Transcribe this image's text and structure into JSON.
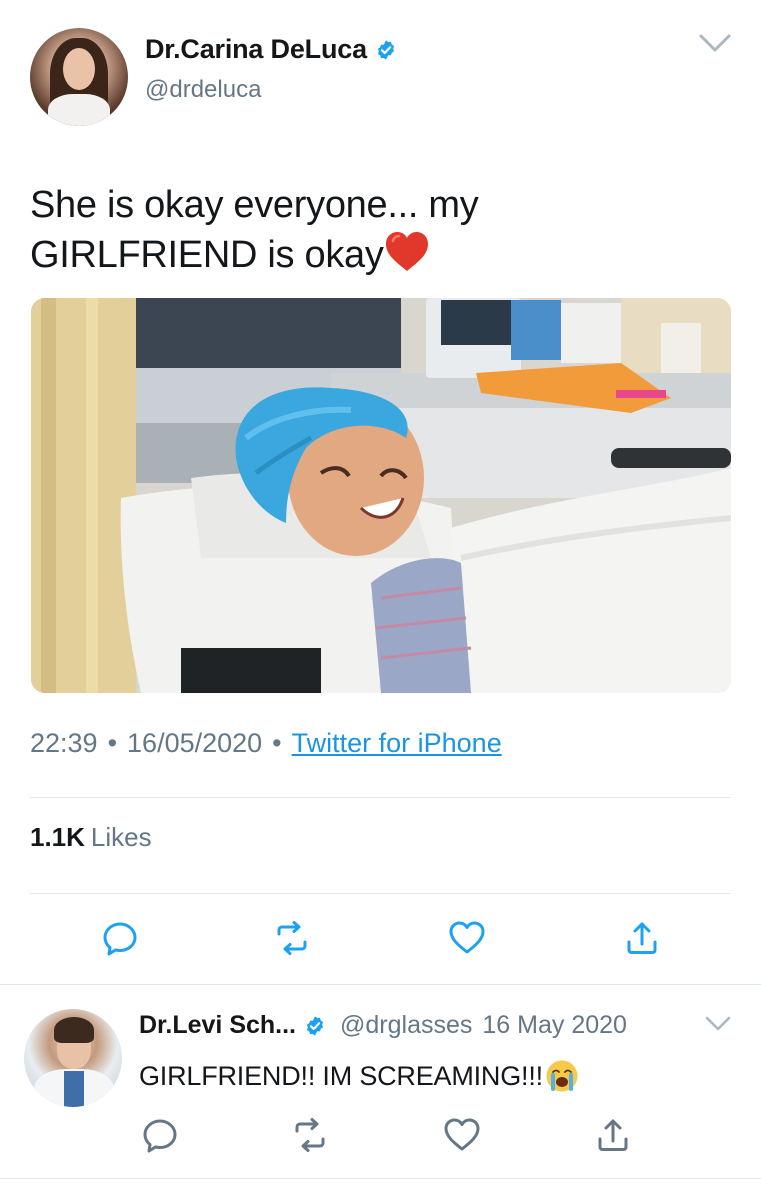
{
  "tweet": {
    "display_name": "Dr.Carina DeLuca",
    "handle": "@drdeluca",
    "text_line1": "She is okay everyone... my",
    "text_line2": "GIRLFRIEND is okay",
    "time": "22:39",
    "date": "16/05/2020",
    "separator": "•",
    "source": "Twitter for iPhone",
    "likes_count": "1.1K",
    "likes_label": "Likes"
  },
  "reply": {
    "display_name": "Dr.Levi Sch...",
    "handle": "@drglasses",
    "date": "16 May 2020",
    "text": "GIRLFRIEND!! IM SCREAMING!!!"
  },
  "icons": {
    "verified": "verified-badge-icon",
    "chevron": "chevron-down-icon",
    "heart_emoji": "red-heart-emoji",
    "cry_emoji": "loudly-crying-face-emoji",
    "reply": "reply-icon",
    "retweet": "retweet-icon",
    "like": "like-heart-icon",
    "share": "share-icon"
  },
  "colors": {
    "link": "#1b95e0",
    "verified": "#1da1f2",
    "secondary_text": "#657786",
    "divider": "#e1e8ed"
  }
}
